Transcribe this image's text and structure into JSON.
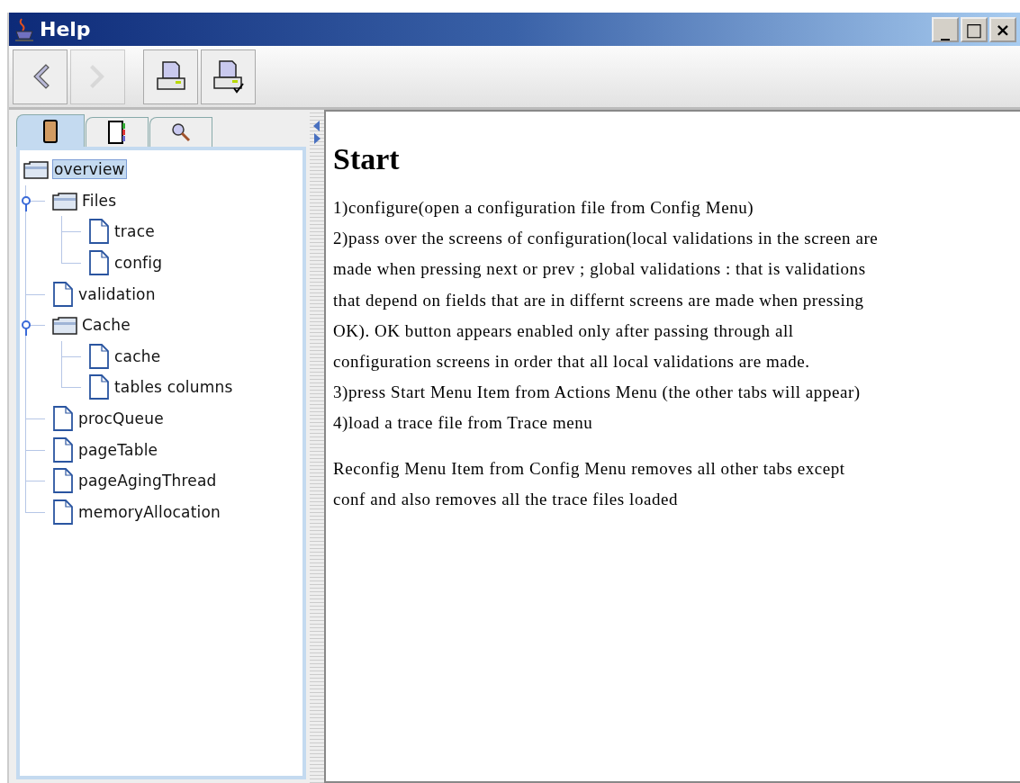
{
  "window": {
    "title": "Help",
    "controls": [
      "_",
      "□",
      "×"
    ]
  },
  "toolbar": [
    {
      "kind": "back",
      "disabled": false
    },
    {
      "kind": "forward",
      "disabled": true
    },
    {
      "kind": "print",
      "disabled": false
    },
    {
      "kind": "print-setup",
      "disabled": false
    }
  ],
  "navigator_tabs": [
    {
      "kind": "contents",
      "selected": true
    },
    {
      "kind": "index",
      "selected": false
    },
    {
      "kind": "search",
      "selected": false
    }
  ],
  "tree": [
    {
      "label": "overview",
      "kind": "folder",
      "selected": true,
      "children": [
        {
          "label": "Files",
          "kind": "folder",
          "selected": false,
          "expanded": true,
          "children": [
            {
              "label": "trace",
              "kind": "page",
              "selected": false
            },
            {
              "label": "config",
              "kind": "page",
              "selected": false
            }
          ]
        },
        {
          "label": "validation",
          "kind": "page",
          "selected": false
        },
        {
          "label": "Cache",
          "kind": "folder",
          "selected": false,
          "expanded": true,
          "children": [
            {
              "label": "cache",
              "kind": "page",
              "selected": false
            },
            {
              "label": "tables columns",
              "kind": "page",
              "selected": false
            }
          ]
        },
        {
          "label": "procQueue",
          "kind": "page",
          "selected": false
        },
        {
          "label": "pageTable",
          "kind": "page",
          "selected": false
        },
        {
          "label": "pageAgingThread",
          "kind": "page",
          "selected": false
        },
        {
          "label": "memoryAllocation",
          "kind": "page",
          "selected": false
        }
      ]
    }
  ],
  "content": {
    "heading": "Start",
    "paragraphs": [
      [
        "1)configure(open a configuration file from Config Menu)",
        "2)pass over the screens of configuration(local validations in the screen are",
        "made when pressing next or prev ; global validations : that is validations",
        "that depend on fields that are in differnt screens are made when pressing",
        "OK).  OK button appears enabled only after passing through all",
        "configuration screens in order that all local validations are made.",
        "3)press Start Menu Item from Actions Menu (the other tabs will appear)",
        "4)load a trace file from Trace menu"
      ],
      [
        "Reconfig Menu Item from Config Menu removes all other tabs except",
        "conf and also removes all the trace files loaded"
      ]
    ]
  }
}
